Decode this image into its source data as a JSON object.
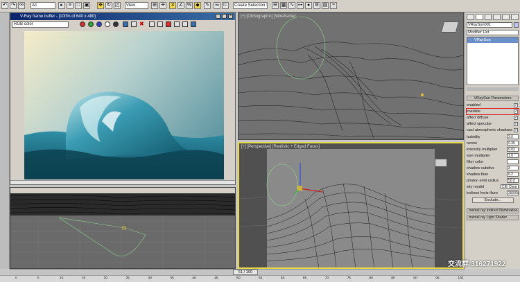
{
  "toolbar": {
    "filter_value": "All",
    "refcoord_value": "View",
    "selection_set_placeholder": "Create Selection Set"
  },
  "vfb": {
    "title": "V-Ray frame buffer - [100% of 640 x 480]",
    "channel": "RGB color"
  },
  "viewports": {
    "top_label": "[+] [Orthographic] [Wireframe]",
    "left_label": "",
    "persp_label": "[+] [Perspective] [Realistic + Edged Faces]"
  },
  "command_panel": {
    "object_name": "VRaySun001",
    "modifier_list": "Modifier List",
    "stack_item": "VRaySun",
    "rollout_title": "VRaySun Parameters",
    "params": [
      {
        "label": "enabled",
        "checked": true
      },
      {
        "label": "invisible",
        "checked": true,
        "highlight": true
      },
      {
        "label": "affect diffuse",
        "checked": true
      },
      {
        "label": "affect specular",
        "checked": true
      },
      {
        "label": "cast atmospheric shadows",
        "checked": true
      }
    ],
    "spinners": [
      {
        "label": "turbidity",
        "value": "3.0"
      },
      {
        "label": "ozone",
        "value": "0.35"
      },
      {
        "label": "intensity multiplier",
        "value": "0.02"
      },
      {
        "label": "size multiplier",
        "value": "1.0"
      },
      {
        "label": "filter color",
        "value": ""
      },
      {
        "label": "shadow subdivs",
        "value": "3"
      },
      {
        "label": "shadow bias",
        "value": "0.2"
      },
      {
        "label": "photon emit radius",
        "value": "50.0"
      },
      {
        "label": "sky model",
        "value": "CIE Clear"
      },
      {
        "label": "indirect horiz illum",
        "value": "25000.0"
      }
    ],
    "exclude_label": "Exclude...",
    "rollout2": "mental ray Indirect Illumination",
    "rollout3": "mental ray Light Shader"
  },
  "timeline": {
    "frame_counter": "51 / 100"
  },
  "ruler": {
    "ticks": [
      "0",
      "5",
      "10",
      "15",
      "20",
      "25",
      "30",
      "35",
      "40",
      "45",
      "50",
      "55",
      "60",
      "65",
      "70",
      "75",
      "80",
      "85",
      "90",
      "95",
      "100"
    ]
  },
  "watermark": "交流群:316271922"
}
